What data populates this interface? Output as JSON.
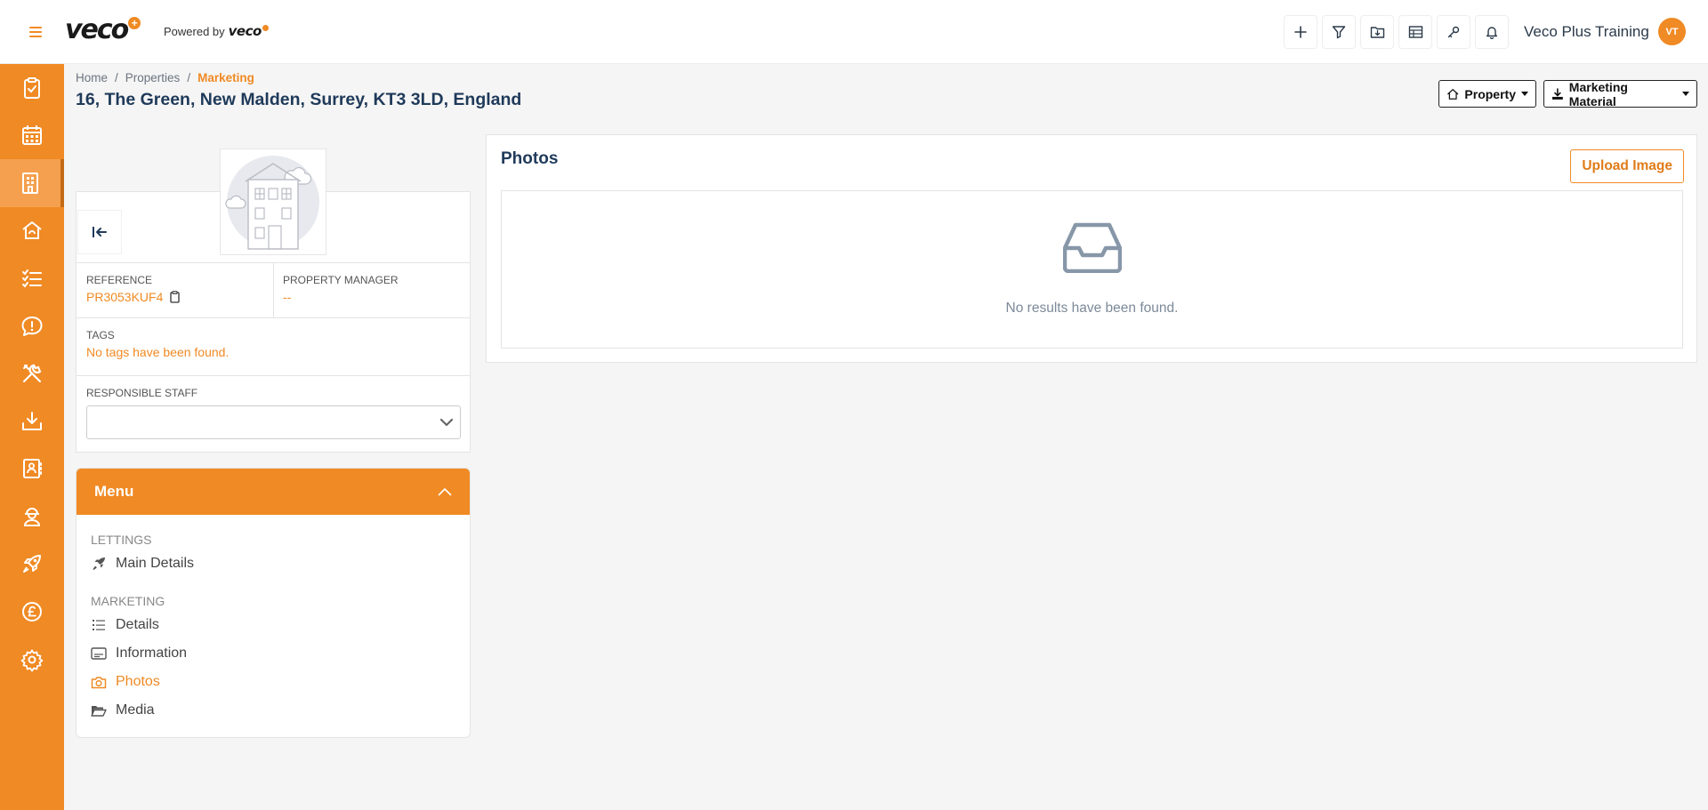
{
  "app": {
    "logo_text": "veco",
    "logo_badge": "+",
    "powered_by": "Powered by",
    "powered_logo": "veco"
  },
  "topbar": {
    "icons": [
      "plus-icon",
      "filter-icon",
      "folder-download-icon",
      "table-icon",
      "key-icon",
      "bell-icon"
    ],
    "user_name": "Veco Plus Training",
    "avatar_initials": "VT"
  },
  "sidebar": {
    "items": [
      {
        "icon": "clipboard-check-icon"
      },
      {
        "icon": "calendar-icon"
      },
      {
        "icon": "building-icon",
        "active": true
      },
      {
        "icon": "house-icon"
      },
      {
        "icon": "checklist-icon"
      },
      {
        "icon": "chat-alert-icon"
      },
      {
        "icon": "tools-icon"
      },
      {
        "icon": "download-tray-icon"
      },
      {
        "icon": "contact-book-icon"
      },
      {
        "icon": "worker-icon"
      },
      {
        "icon": "rocket-icon"
      },
      {
        "icon": "pound-icon"
      },
      {
        "icon": "gear-icon"
      }
    ]
  },
  "breadcrumb": {
    "home": "Home",
    "properties": "Properties",
    "current": "Marketing",
    "separator": "/"
  },
  "page_title": "16, The Green, New Malden, Surrey, KT3 3LD, England",
  "header_buttons": {
    "property": "Property",
    "marketing_material": "Marketing Material"
  },
  "property_card": {
    "reference_label": "REFERENCE",
    "reference_value": "PR3053KUF4",
    "manager_label": "PROPERTY MANAGER",
    "manager_value": "--",
    "tags_label": "TAGS",
    "tags_value": "No tags have been found.",
    "staff_label": "RESPONSIBLE STAFF",
    "staff_value": ""
  },
  "menu": {
    "title": "Menu",
    "sections": [
      {
        "label": "LETTINGS",
        "items": [
          {
            "label": "Main Details",
            "icon": "rocket-icon"
          }
        ]
      },
      {
        "label": "MARKETING",
        "items": [
          {
            "label": "Details",
            "icon": "list-icon"
          },
          {
            "label": "Information",
            "icon": "card-icon"
          },
          {
            "label": "Photos",
            "icon": "camera-icon",
            "active": true
          },
          {
            "label": "Media",
            "icon": "folder-open-icon"
          }
        ]
      }
    ]
  },
  "photos": {
    "title": "Photos",
    "upload_label": "Upload Image",
    "empty_text": "No results have been found."
  },
  "colors": {
    "accent": "#f08a24",
    "title": "#1f3a5a"
  }
}
